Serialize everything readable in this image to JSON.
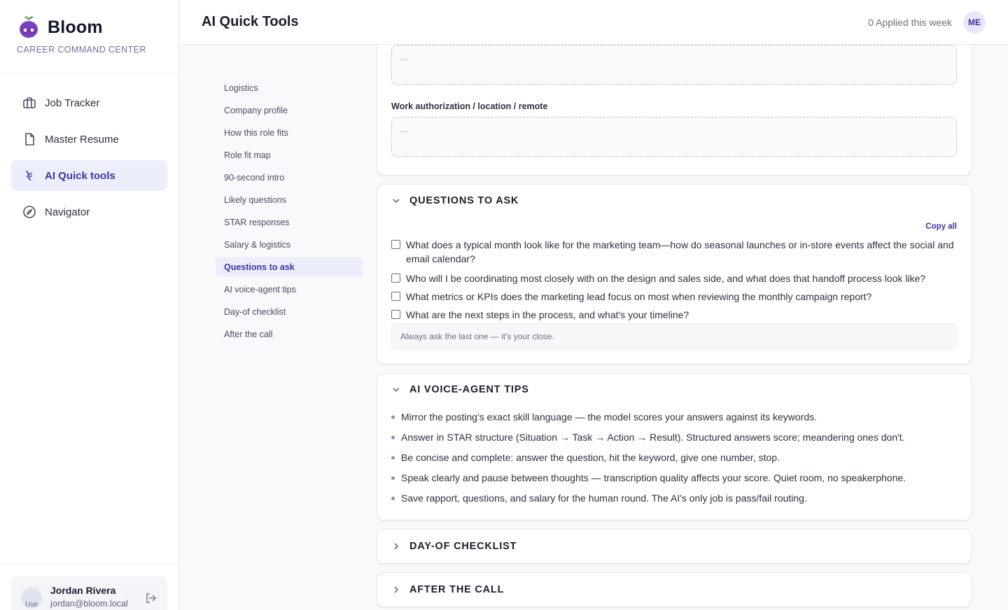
{
  "brand": {
    "name": "Bloom",
    "subtitle": "CAREER COMMAND CENTER"
  },
  "nav": [
    {
      "label": "Job Tracker",
      "icon": "briefcase-icon"
    },
    {
      "label": "Master Resume",
      "icon": "document-icon"
    },
    {
      "label": "AI Quick tools",
      "icon": "spark-icon",
      "active": true
    },
    {
      "label": "Navigator",
      "icon": "compass-icon"
    }
  ],
  "user": {
    "name": "Jordan Rivera",
    "email": "jordan@bloom.local",
    "avatar_alt": "Use"
  },
  "header": {
    "title": "AI Quick Tools",
    "applied": "0 Applied this week",
    "avatar_initials": "ME"
  },
  "sections": [
    "Logistics",
    "Company profile",
    "How this role fits",
    "Role fit map",
    "90-second intro",
    "Likely questions",
    "STAR responses",
    "Salary & logistics",
    "Questions to ask",
    "AI voice-agent tips",
    "Day-of checklist",
    "After the call"
  ],
  "active_section": "Questions to ask",
  "top_card": {
    "textarea1_value": "...",
    "field_label": "Work authorization / location / remote",
    "textarea2_value": "..."
  },
  "questions_card": {
    "title": "QUESTIONS TO ASK",
    "copy_all": "Copy all",
    "questions": [
      "What does a typical month look like for the marketing team—how do seasonal launches or in-store events affect the social and email calendar?",
      "Who will I be coordinating most closely with on the design and sales side, and what does that handoff process look like?",
      "What metrics or KPIs does the marketing lead focus on most when reviewing the monthly campaign report?",
      "What are the next steps in the process, and what's your timeline?"
    ],
    "note": "Always ask the last one — it's your close."
  },
  "tips_card": {
    "title": "AI VOICE-AGENT TIPS",
    "tips": [
      "Mirror the posting's exact skill language — the model scores your answers against its keywords.",
      "Answer in STAR structure (Situation → Task → Action → Result). Structured answers score; meandering ones don't.",
      "Be concise and complete: answer the question, hit the keyword, give one number, stop.",
      "Speak clearly and pause between thoughts — transcription quality affects your score. Quiet room, no speakerphone.",
      "Save rapport, questions, and salary for the human round. The AI's only job is pass/fail routing."
    ]
  },
  "checklist_card": {
    "title": "DAY-OF CHECKLIST"
  },
  "after_card": {
    "title": "AFTER THE CALL"
  },
  "colors": {
    "accent": "#3b35a0",
    "active_bg": "#eceefb",
    "brand_purple": "#7b3fc4"
  }
}
